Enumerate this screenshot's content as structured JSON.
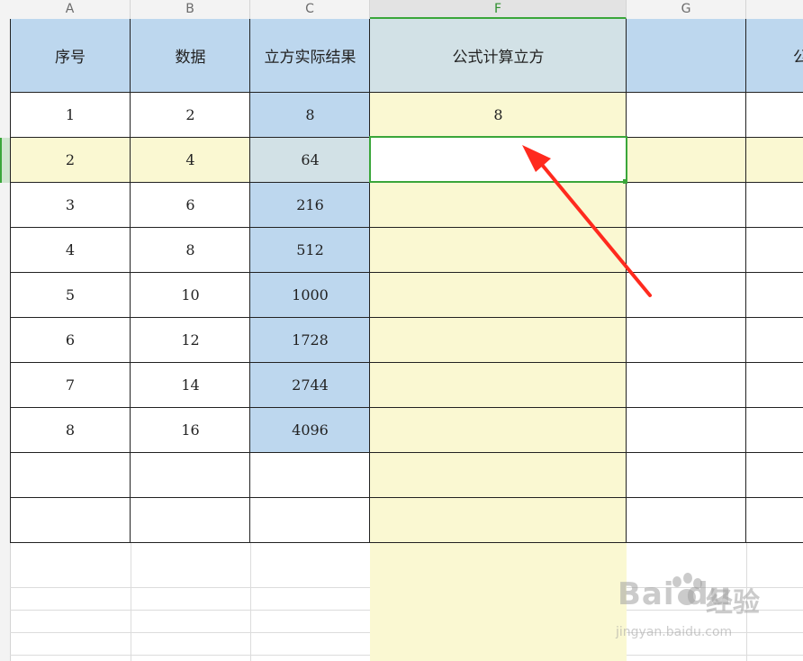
{
  "column_headers": [
    "A",
    "B",
    "C",
    "F",
    "G"
  ],
  "table_headers": [
    "序号",
    "数据",
    "立方实际结果",
    "公式计算立方",
    "",
    "公"
  ],
  "rows": [
    {
      "seq": "1",
      "data": "2",
      "actual": "8",
      "formula": "8"
    },
    {
      "seq": "2",
      "data": "4",
      "actual": "64",
      "formula": ""
    },
    {
      "seq": "3",
      "data": "6",
      "actual": "216",
      "formula": ""
    },
    {
      "seq": "4",
      "data": "8",
      "actual": "512",
      "formula": ""
    },
    {
      "seq": "5",
      "data": "10",
      "actual": "1000",
      "formula": ""
    },
    {
      "seq": "6",
      "data": "12",
      "actual": "1728",
      "formula": ""
    },
    {
      "seq": "7",
      "data": "14",
      "actual": "2744",
      "formula": ""
    },
    {
      "seq": "8",
      "data": "16",
      "actual": "4096",
      "formula": ""
    }
  ],
  "watermark": {
    "logo": "Bai du",
    "cn": "经验",
    "url": "jingyan.baidu.com"
  },
  "colors": {
    "header_fill": "#bdd7ee",
    "actual_fill": "#bdd7ee",
    "formula_fill": "#faf8d2",
    "active_row_fill": "#faf8d2",
    "selection": "#3aa63a",
    "arrow": "#ff2a1e"
  }
}
